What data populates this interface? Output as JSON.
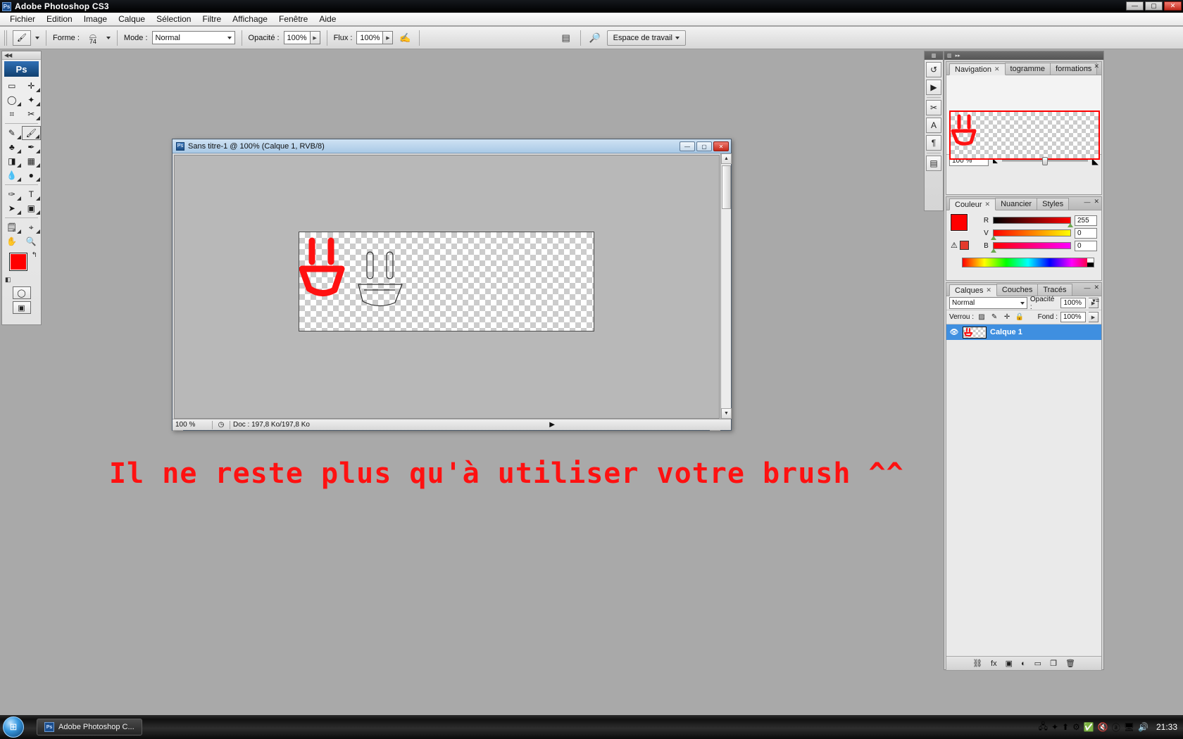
{
  "window": {
    "app_title": "Adobe Photoshop CS3",
    "app_badge": "Ps",
    "minimize": "—",
    "maximize": "▢",
    "close": "✕"
  },
  "menubar": {
    "items": [
      "Fichier",
      "Edition",
      "Image",
      "Calque",
      "Sélection",
      "Filtre",
      "Affichage",
      "Fenêtre",
      "Aide"
    ]
  },
  "options_bar": {
    "tool_icon": "brush-icon",
    "forme_label": "Forme :",
    "brush_size": "74",
    "mode_label": "Mode :",
    "mode_value": "Normal",
    "opacite_label": "Opacité :",
    "opacite_value": "100%",
    "flux_label": "Flux :",
    "flux_value": "100%",
    "airbrush_icon": "airbrush-icon",
    "palettes_icon": "palettes-icon",
    "bridge_icon": "bridge-icon",
    "workspace_label": "Espace de travail"
  },
  "toolbox": {
    "collapse_icon": "◀◀",
    "logo": "Ps",
    "tools": [
      {
        "name": "marquee-tool",
        "glyph": "▭"
      },
      {
        "name": "move-tool",
        "glyph": "✛"
      },
      {
        "name": "lasso-tool",
        "glyph": "◯"
      },
      {
        "name": "magic-wand-tool",
        "glyph": "✦"
      },
      {
        "name": "crop-tool",
        "glyph": "⌗"
      },
      {
        "name": "slice-tool",
        "glyph": "✂"
      },
      {
        "name": "healing-brush-tool",
        "glyph": "✎"
      },
      {
        "name": "brush-tool",
        "glyph": "🖌"
      },
      {
        "name": "clone-stamp-tool",
        "glyph": "♣"
      },
      {
        "name": "history-brush-tool",
        "glyph": "✒"
      },
      {
        "name": "eraser-tool",
        "glyph": "◨"
      },
      {
        "name": "gradient-tool",
        "glyph": "▦"
      },
      {
        "name": "blur-tool",
        "glyph": "💧"
      },
      {
        "name": "dodge-tool",
        "glyph": "●"
      },
      {
        "name": "pen-tool",
        "glyph": "✑"
      },
      {
        "name": "type-tool",
        "glyph": "T"
      },
      {
        "name": "path-selection-tool",
        "glyph": "➤"
      },
      {
        "name": "shape-tool",
        "glyph": "▣"
      },
      {
        "name": "notes-tool",
        "glyph": "🗒"
      },
      {
        "name": "eyedropper-tool",
        "glyph": "⌖"
      },
      {
        "name": "hand-tool",
        "glyph": "✋"
      },
      {
        "name": "zoom-tool",
        "glyph": "🔍"
      }
    ],
    "foreground_color": "#ff0000",
    "background_color": "#ffffff",
    "swap_icon": "↰",
    "default_icon": "◧",
    "quickmask_icon": "◯",
    "screenmode_icon": "▣"
  },
  "document": {
    "icon": "ps-doc-icon",
    "title": "Sans titre-1 @ 100% (Calque 1, RVB/8)",
    "minimize": "—",
    "maximize": "▢",
    "close": "✕",
    "status_zoom": "100 %",
    "doc_info": "Doc : 197,8 Ko/197,8 Ko",
    "artwork": {
      "red_stroke": "red brush face stamp",
      "outline_stroke": "black outline face"
    }
  },
  "dock_rail": {
    "buttons": [
      {
        "name": "history-rail-icon",
        "glyph": "↺"
      },
      {
        "name": "actions-rail-icon",
        "glyph": "▶"
      },
      {
        "name": "tool-presets-rail-icon",
        "glyph": "✂"
      },
      {
        "name": "character-rail-icon",
        "glyph": "A"
      },
      {
        "name": "paragraph-rail-icon",
        "glyph": "¶"
      },
      {
        "name": "layer-comps-rail-icon",
        "glyph": "▤"
      }
    ]
  },
  "navigator_panel": {
    "tabs": [
      {
        "label": "Navigation",
        "closable": true,
        "active": true
      },
      {
        "label": "togramme",
        "closable": false,
        "active": false
      },
      {
        "label": "formations",
        "closable": false,
        "active": false
      }
    ],
    "zoom_value": "100 %",
    "zoom_out_icon": "small-mountain-icon",
    "zoom_in_icon": "large-mountain-icon",
    "collapse": "—",
    "close": "✕"
  },
  "color_panel": {
    "tabs": [
      {
        "label": "Couleur",
        "closable": true,
        "active": true
      },
      {
        "label": "Nuancier",
        "closable": false,
        "active": false
      },
      {
        "label": "Styles",
        "closable": false,
        "active": false
      }
    ],
    "channels": [
      {
        "label": "R",
        "value": "255",
        "pos": 100
      },
      {
        "label": "V",
        "value": "0",
        "pos": 0
      },
      {
        "label": "B",
        "value": "0",
        "pos": 0
      }
    ],
    "warning_icon": "out-of-gamut-icon",
    "foreground": "#ff0000",
    "background": "#ffffff",
    "collapse": "—",
    "close": "✕"
  },
  "layers_panel": {
    "tabs": [
      {
        "label": "Calques",
        "closable": true,
        "active": true
      },
      {
        "label": "Couches",
        "closable": false,
        "active": false
      },
      {
        "label": "Tracés",
        "closable": false,
        "active": false
      }
    ],
    "blend_mode": "Normal",
    "opacity_label": "Opacité :",
    "opacity_value": "100%",
    "lock_label": "Verrou :",
    "lock_icons": [
      {
        "name": "lock-transparent-icon",
        "glyph": "▨"
      },
      {
        "name": "lock-image-icon",
        "glyph": "✎"
      },
      {
        "name": "lock-position-icon",
        "glyph": "✛"
      },
      {
        "name": "lock-all-icon",
        "glyph": "🔒"
      }
    ],
    "fill_label": "Fond :",
    "fill_value": "100%",
    "layers": [
      {
        "name": "Calque 1",
        "visible": true,
        "selected": true
      }
    ],
    "footer_icons": [
      {
        "name": "link-layers-icon",
        "glyph": "⛓"
      },
      {
        "name": "layer-style-icon",
        "glyph": "fx"
      },
      {
        "name": "layer-mask-icon",
        "glyph": "▣"
      },
      {
        "name": "adjustment-layer-icon",
        "glyph": "◐"
      },
      {
        "name": "new-group-icon",
        "glyph": "▭"
      },
      {
        "name": "new-layer-icon",
        "glyph": "❐"
      },
      {
        "name": "delete-layer-icon",
        "glyph": "🗑"
      }
    ],
    "collapse": "—",
    "close": "✕"
  },
  "caption": {
    "text": "Il ne reste plus qu'à utiliser votre brush ^^",
    "color": "#ff1111"
  },
  "taskbar": {
    "start_icon": "windows-start-orb",
    "task_badge": "Ps",
    "task_label": "Adobe Photoshop C...",
    "tray_icons": [
      {
        "name": "network-icon",
        "glyph": "🖧"
      },
      {
        "name": "bluetooth-icon",
        "glyph": "✦"
      },
      {
        "name": "update-icon",
        "glyph": "⬆"
      },
      {
        "name": "settings-icon",
        "glyph": "⚙"
      },
      {
        "name": "safely-remove-icon",
        "glyph": "✅"
      },
      {
        "name": "volume-muted-icon",
        "glyph": "🔇"
      },
      {
        "name": "antivirus-icon",
        "glyph": "ⓐ"
      },
      {
        "name": "network-status-icon",
        "glyph": "🖥"
      },
      {
        "name": "volume-icon",
        "glyph": "🔊"
      }
    ],
    "clock": "21:33"
  }
}
